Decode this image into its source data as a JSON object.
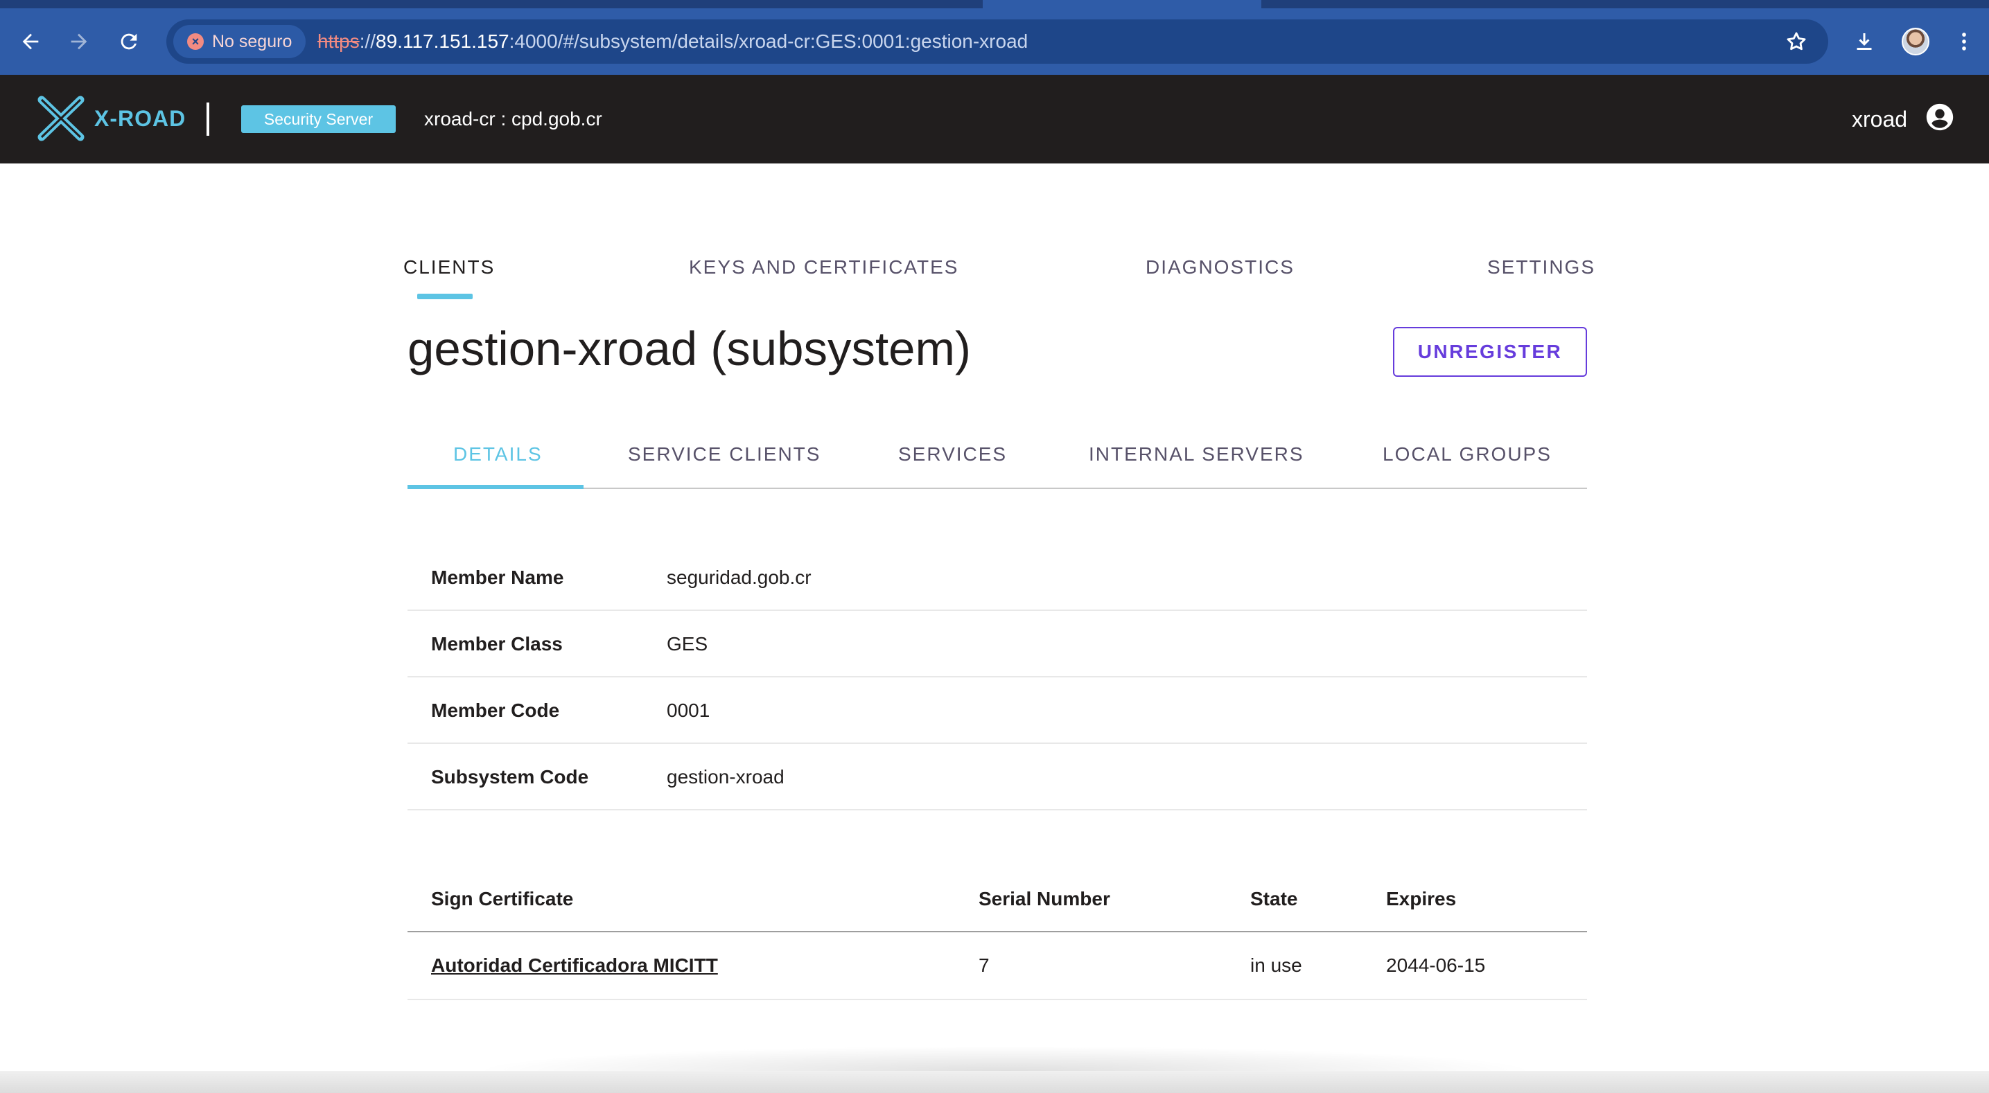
{
  "browser": {
    "security_chip": "No seguro",
    "url_scheme": "https",
    "url_sep": "://",
    "url_host": "89.117.151.157",
    "url_rest": ":4000/#/subsystem/details/xroad-cr:GES:0001:gestion-xroad"
  },
  "header": {
    "logo_text": "X-ROAD",
    "server_badge": "Security Server",
    "server_id": "xroad-cr : cpd.gob.cr",
    "user_name": "xroad"
  },
  "main_tabs": [
    {
      "label": "CLIENTS",
      "active": true
    },
    {
      "label": "KEYS AND CERTIFICATES",
      "active": false
    },
    {
      "label": "DIAGNOSTICS",
      "active": false
    },
    {
      "label": "SETTINGS",
      "active": false
    }
  ],
  "page": {
    "title": "gestion-xroad (subsystem)",
    "unregister_label": "UNREGISTER"
  },
  "sub_tabs": [
    {
      "label": "DETAILS",
      "active": true
    },
    {
      "label": "SERVICE CLIENTS",
      "active": false
    },
    {
      "label": "SERVICES",
      "active": false
    },
    {
      "label": "INTERNAL SERVERS",
      "active": false
    },
    {
      "label": "LOCAL GROUPS",
      "active": false
    }
  ],
  "details": [
    {
      "label": "Member Name",
      "value": "seguridad.gob.cr"
    },
    {
      "label": "Member Class",
      "value": "GES"
    },
    {
      "label": "Member Code",
      "value": "0001"
    },
    {
      "label": "Subsystem Code",
      "value": "gestion-xroad"
    }
  ],
  "certificates": {
    "headers": [
      "Sign Certificate",
      "Serial Number",
      "State",
      "Expires"
    ],
    "rows": [
      [
        "Autoridad Certificadora MICITT",
        "7",
        "in use",
        "2044-06-15"
      ]
    ]
  },
  "colors": {
    "accent": "#5dc4e4",
    "primary": "#663cdc",
    "header_bg": "#211e1e",
    "browser_bar": "#2f5ca8"
  }
}
